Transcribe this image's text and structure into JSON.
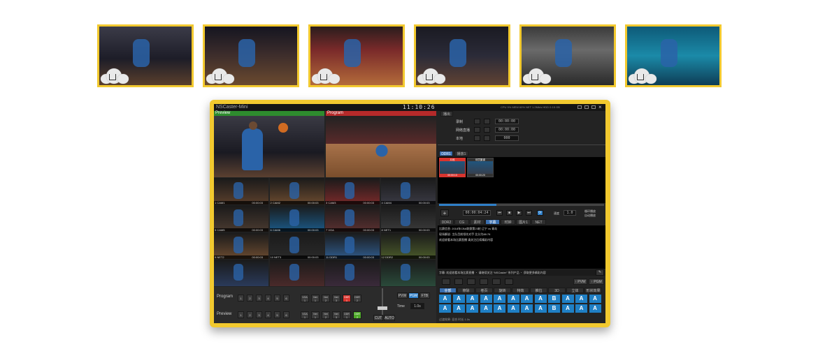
{
  "thumbnails": [
    {
      "name": "player-shooting"
    },
    {
      "name": "tipoff-wide"
    },
    {
      "name": "arena-crowd"
    },
    {
      "name": "player-layup"
    },
    {
      "name": "bench-celebration"
    },
    {
      "name": "team-poster"
    }
  ],
  "window": {
    "app_title": "NSCaster-Mini",
    "clock": "11:10:26",
    "sys_info": "CPU 9%  MEM 60%  NET 1.2Mb/s  HDD 0.15 GB"
  },
  "monitors": {
    "preview_label": "Preview",
    "program_label": "Program"
  },
  "multiview": [
    {
      "label": "1 CAM1",
      "time": "00:00:03"
    },
    {
      "label": "2 CAM2",
      "time": "00:00:03"
    },
    {
      "label": "3 CAM3",
      "time": "00:00:03"
    },
    {
      "label": "4 CAM4",
      "time": "00:00:03"
    },
    {
      "label": "5 CAM5",
      "time": "00:00:03"
    },
    {
      "label": "6 CAM6",
      "time": "00:00:03"
    },
    {
      "label": "7 VGA",
      "time": "00:00:03"
    },
    {
      "label": "8 NET1",
      "time": "00:00:03"
    },
    {
      "label": "9 NET2",
      "time": "00:00:03"
    },
    {
      "label": "10 NET3",
      "time": "00:00:03"
    },
    {
      "label": "11 DDR1",
      "time": "00:00:03"
    },
    {
      "label": "12 DDR2",
      "time": "00:00:03"
    },
    {
      "label": "",
      "time": ""
    },
    {
      "label": "",
      "time": ""
    },
    {
      "label": "",
      "time": ""
    },
    {
      "label": "",
      "time": ""
    }
  ],
  "switcher": {
    "program_label": "Program",
    "preview_label": "Preview",
    "numbers": [
      "1",
      "2",
      "3",
      "4",
      "5",
      "6"
    ],
    "sources": [
      {
        "top": "VGA",
        "bot": "1"
      },
      {
        "top": "Net",
        "bot": "1"
      },
      {
        "top": "Net",
        "bot": "2"
      },
      {
        "top": "Net",
        "bot": "3"
      },
      {
        "top": "DDR",
        "bot": "1"
      },
      {
        "top": "DDR",
        "bot": "2"
      }
    ],
    "pvw_label": "PVW",
    "pgm_label": "PGM",
    "ftb_label": "FTB",
    "time_label": "Time",
    "time_value": "1.0s",
    "cut_label": "CUT",
    "auto_label": "AUTO"
  },
  "right_panel": {
    "top_tab": "播出",
    "record_rows": [
      {
        "label": "录制",
        "time": "00:00:00"
      },
      {
        "label": "网络直播",
        "time": "00:00:00"
      },
      {
        "label": "本地",
        "time": "000"
      }
    ],
    "ddr_tabs": [
      "DDR1",
      "播放1"
    ],
    "clips": [
      {
        "title": "片段",
        "meta": "00:00:13"
      },
      {
        "title": "球员集锦",
        "meta": "00:00:20"
      }
    ],
    "transport_time": "00:00:04:24",
    "speed_label": "速度",
    "speed_value": "1.0",
    "check1": "循环播放",
    "check2": "自动播放",
    "subtitle_tabs": [
      "DDR2",
      "CG",
      "素材",
      "字幕",
      "时钟",
      "图片1",
      "NET"
    ],
    "subtitle_lines": [
      "比赛信息: 2018年CBA联赛第23轮 辽宁 vs 青岛",
      "现场解说: 主队目前领先对手 比分为88:76",
      "欢迎收看本场比赛直播 请关注后续精彩内容"
    ],
    "ticker_text": "字幕: 欢迎收看本场比赛直播 ‧ 请继续关注 “NSCaster” 系列产品 ‧ 获取更多精彩内容",
    "pvw_btn": "↑ PVW",
    "pgm_btn": "↑ PGM",
    "effect_tabs": [
      "全部",
      "擦除",
      "卷页",
      "旋转",
      "特效",
      "推拉",
      "3D",
      "立体",
      "形状效果"
    ],
    "glyphs": [
      "A",
      "A",
      "A",
      "A",
      "A",
      "A",
      "A",
      "A",
      "B",
      "A",
      "A",
      "A",
      "A",
      "A",
      "A",
      "A",
      "A",
      "A",
      "A",
      "A",
      "B",
      "A",
      "A",
      "A"
    ],
    "status_text": "过渡效果: 混合  时长 1.0s"
  },
  "colors": {
    "frame": "#f2c92f",
    "preview_bar": "#2e8b2e",
    "program_bar": "#b52a2a",
    "accent_blue": "#2f7fc8"
  }
}
